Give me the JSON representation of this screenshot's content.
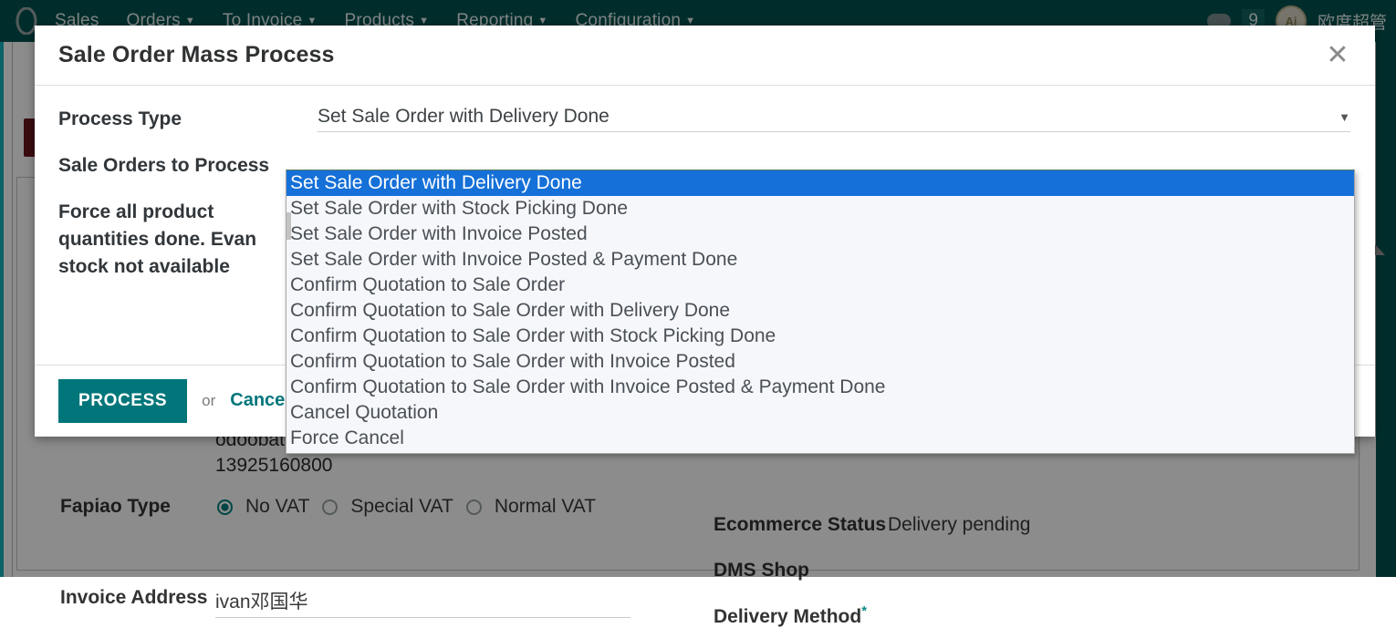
{
  "navbar": {
    "brand_icon": "odoo-logo-icon",
    "items": [
      {
        "label": "Sales",
        "has_caret": false
      },
      {
        "label": "Orders",
        "has_caret": true
      },
      {
        "label": "To Invoice",
        "has_caret": true
      },
      {
        "label": "Products",
        "has_caret": true
      },
      {
        "label": "Reporting",
        "has_caret": true
      },
      {
        "label": "Configuration",
        "has_caret": true
      }
    ],
    "messages_count": "9",
    "avatar_initials": "Ai",
    "user_name": "欧度超管"
  },
  "modal": {
    "title": "Sale Order Mass Process",
    "close_icon": "close-icon",
    "fields": {
      "process_type_label": "Process Type",
      "sale_orders_label": "Sale Orders to Process",
      "force_quantities_label": "Force all product quantities done. Evan stock not available",
      "process_type_value": "Set Sale Order with Delivery Done",
      "caret_icon": "chevron-down-icon"
    },
    "footer": {
      "process_label": "PROCESS",
      "or_label": "or",
      "cancel_label": "Cancel"
    }
  },
  "select_popup": {
    "selected_index": 0,
    "options": [
      "Set Sale Order with Delivery Done",
      "Set Sale Order with Stock Picking Done",
      "Set Sale Order with Invoice Posted",
      "Set Sale Order with Invoice Posted & Payment Done",
      "Confirm Quotation to Sale Order",
      "Confirm Quotation to Sale Order with Delivery Done",
      "Confirm Quotation to Sale Order with Stock Picking Done",
      "Confirm Quotation to Sale Order with Invoice Posted",
      "Confirm Quotation to Sale Order with Invoice Posted & Payment Done",
      "Cancel Quotation",
      "Force Cancel"
    ]
  },
  "background_form": {
    "email_partial": "odoobat.c",
    "phone": "13925160800",
    "fapiao_type_label": "Fapiao Type",
    "fapiao_options": [
      {
        "label": "No VAT",
        "selected": true
      },
      {
        "label": "Special VAT",
        "selected": false
      },
      {
        "label": "Normal VAT",
        "selected": false
      }
    ],
    "invoice_address_label": "Invoice Address",
    "invoice_address_value": "ivan邓国华",
    "ecommerce_status_label": "Ecommerce Status",
    "ecommerce_status_value": "Delivery pending",
    "dms_shop_label": "DMS Shop",
    "dms_shop_value": "",
    "delivery_method_label": "Delivery Method",
    "delivery_method_required": "*"
  },
  "colors": {
    "navbar_bg": "#00524f",
    "accent_teal": "#00767a",
    "select_highlight": "#1570d8",
    "alert_red": "#6b1620",
    "left_rail": "#15b3bd"
  }
}
